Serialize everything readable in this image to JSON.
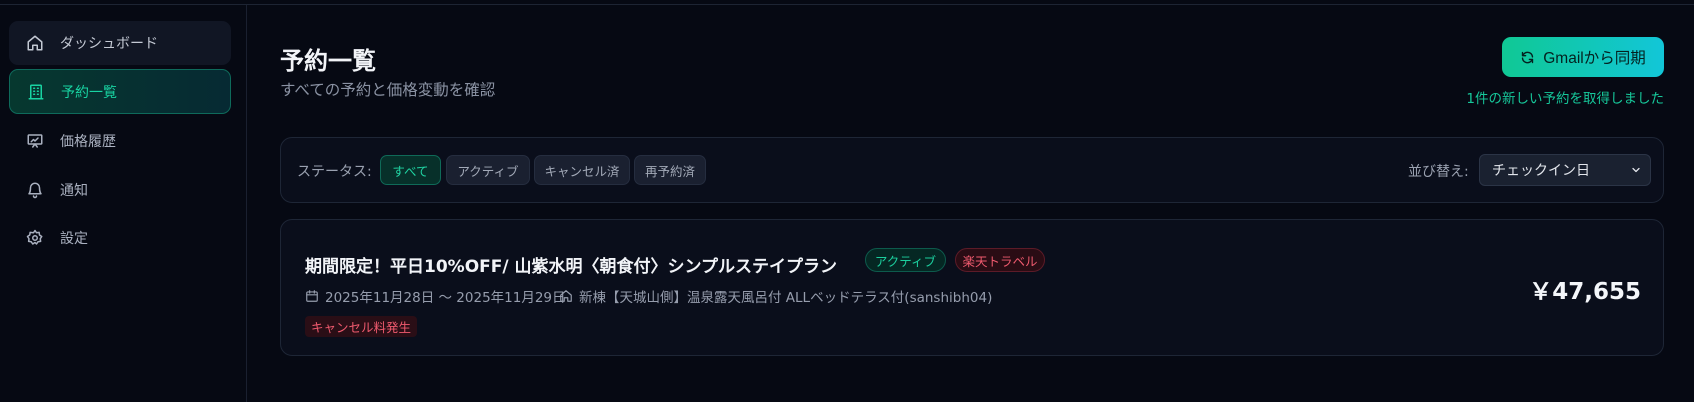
{
  "sidebar": {
    "items": [
      {
        "label": "ダッシュボード",
        "icon": "home-icon"
      },
      {
        "label": "予約一覧",
        "icon": "building-icon"
      },
      {
        "label": "価格履歴",
        "icon": "chart-board-icon"
      },
      {
        "label": "通知",
        "icon": "bell-icon"
      },
      {
        "label": "設定",
        "icon": "gear-icon"
      }
    ]
  },
  "header": {
    "title": "予約一覧",
    "subtitle": "すべての予約と価格変動を確認",
    "sync_button": "Gmailから同期",
    "sync_message": "1件の新しい予約を取得しました"
  },
  "filters": {
    "status_label": "ステータス:",
    "chips": [
      "すべて",
      "アクティブ",
      "キャンセル済",
      "再予約済"
    ],
    "selected": "すべて",
    "sort_label": "並び替え:",
    "sort_value": "チェックイン日"
  },
  "reservations": [
    {
      "title": "期間限定！平日10%OFF/ 山紫水明〈朝食付〉シンプルステイプラン",
      "status": "アクティブ",
      "source": "楽天トラベル",
      "dates": "2025年11月28日 〜 2025年11月29日",
      "room": "新棟【天城山側】温泉露天風呂付 ALLベッドテラス付(sanshibh04)",
      "fee_badge": "キャンセル料発生",
      "price": "￥47,655"
    }
  ],
  "colors": {
    "accent": "#16c79a",
    "background": "#060913",
    "card": "#0a0e1b",
    "danger": "#ef5a6e"
  }
}
